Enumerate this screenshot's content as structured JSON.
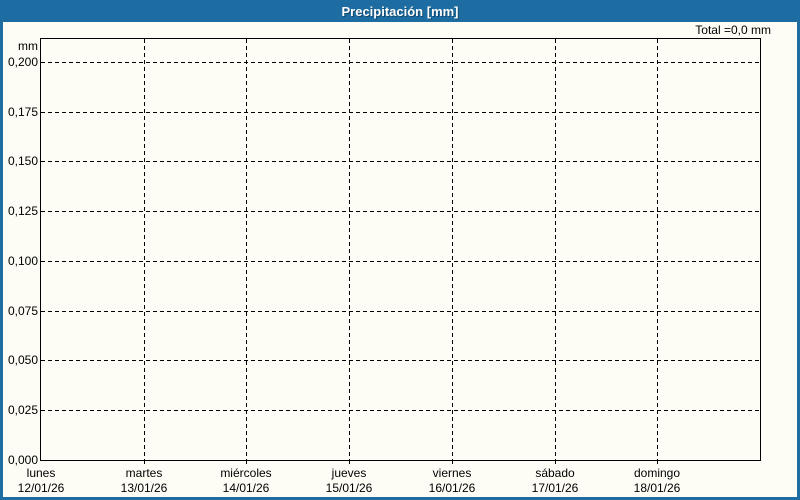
{
  "window": {
    "title": "Precipitación [mm]"
  },
  "total_label": "Total =0,0 mm",
  "y_axis_unit": "mm",
  "chart_data": {
    "type": "line",
    "title": "Precipitación [mm]",
    "xlabel": "",
    "ylabel": "mm",
    "ylim": [
      0,
      0.2115
    ],
    "grid": "dashed",
    "legend_position": "none",
    "total_text": "Total =0,0 mm",
    "y_ticks": [
      {
        "value": 0.0,
        "label": "0,000"
      },
      {
        "value": 0.025,
        "label": "0,025"
      },
      {
        "value": 0.05,
        "label": "0,050"
      },
      {
        "value": 0.075,
        "label": "0,075"
      },
      {
        "value": 0.1,
        "label": "0,100"
      },
      {
        "value": 0.125,
        "label": "0,125"
      },
      {
        "value": 0.15,
        "label": "0,150"
      },
      {
        "value": 0.175,
        "label": "0,175"
      },
      {
        "value": 0.2,
        "label": "0,200"
      }
    ],
    "categories": [
      {
        "day": "lunes",
        "date": "12/01/26"
      },
      {
        "day": "martes",
        "date": "13/01/26"
      },
      {
        "day": "miércoles",
        "date": "14/01/26"
      },
      {
        "day": "jueves",
        "date": "15/01/26"
      },
      {
        "day": "viernes",
        "date": "16/01/26"
      },
      {
        "day": "sábado",
        "date": "17/01/26"
      },
      {
        "day": "domingo",
        "date": "18/01/26"
      }
    ],
    "series": [
      {
        "name": "Precipitación",
        "values": [
          0,
          0,
          0,
          0,
          0,
          0,
          0
        ]
      }
    ]
  },
  "colors": {
    "titlebar": "#1d6da3",
    "border": "#1d6da3",
    "background": "#fdfdf6",
    "grid_and_text": "#000000",
    "title_text": "#ffffff"
  }
}
